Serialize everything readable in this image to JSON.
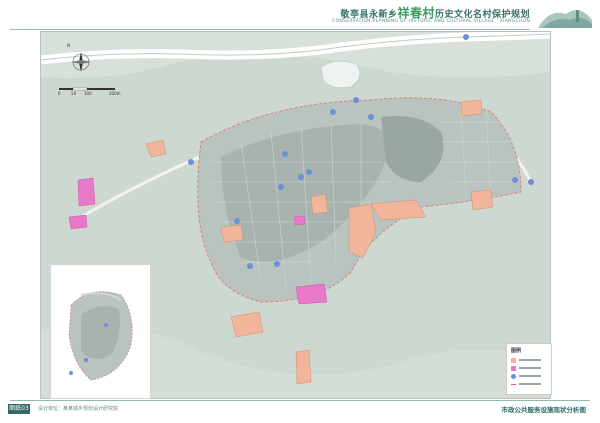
{
  "header": {
    "title_prefix": "敬亭县永新乡",
    "title_village": "祥春村",
    "title_suffix": "历史文化名村保护规划",
    "subtitle": "CONSERVATION PLANNING OF HISTORIC AND CULTURAL VILLAGE · XIANGCHUN"
  },
  "footer": {
    "page_number": "图纸03",
    "left_text": "设计单位：某某城乡规划设计研究院",
    "drawing_title": "市政公共服务设施现状分析图"
  },
  "map": {
    "north_label": "N",
    "scale_labels": [
      "0",
      "50",
      "100",
      "200m"
    ],
    "facility_marker": "P"
  },
  "legend": {
    "title": "图例",
    "items": [
      {
        "color": "#f0b59b"
      },
      {
        "color": "#e879c8"
      },
      {
        "color": "#6d8fd6"
      },
      {
        "color": "#d96060"
      }
    ]
  },
  "colors": {
    "header_accent": "#3f9a5c",
    "public_service_land": "#f0b59b",
    "admin_land": "#e879c8",
    "facility_marker": "#6d8fd6",
    "boundary_line": "#d96060"
  }
}
